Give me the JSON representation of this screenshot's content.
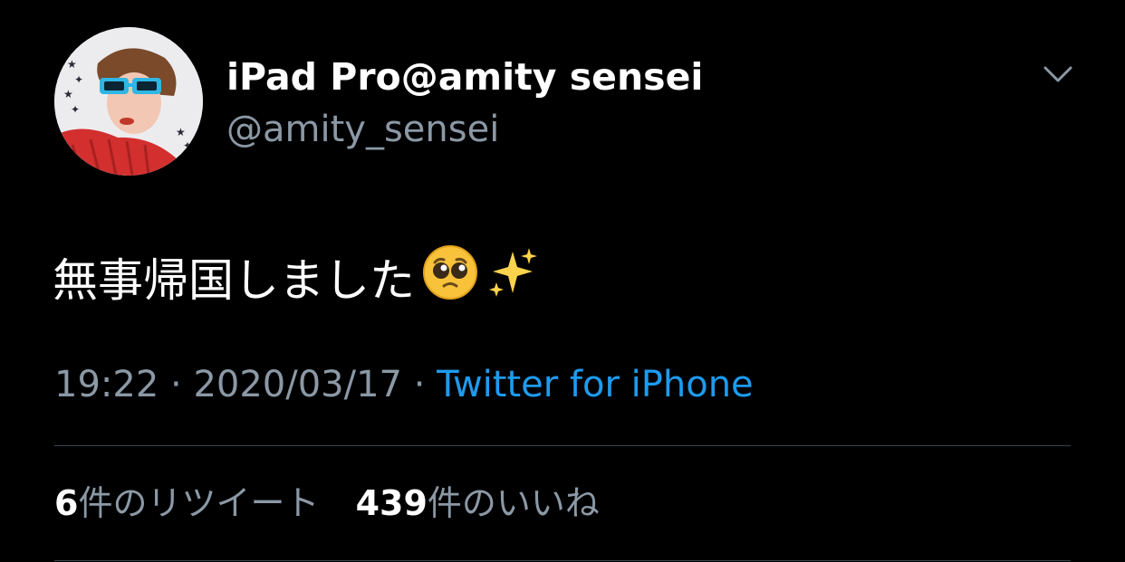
{
  "author": {
    "display_name": "iPad Pro@amity sensei",
    "handle": "@amity_sensei",
    "avatar_icon": "profile-photo-woman-blue-sunglasses"
  },
  "tweet": {
    "text": "無事帰国しました",
    "emoji": [
      "pleading-face-icon",
      "sparkles-icon"
    ]
  },
  "meta": {
    "time": "19:22",
    "separator": "·",
    "date": "2020/03/17",
    "source": "Twitter for iPhone"
  },
  "stats": {
    "retweets_count": "6",
    "retweets_label": "件のリツイート",
    "likes_count": "439",
    "likes_label": "件のいいね"
  },
  "colors": {
    "background": "#000000",
    "primary_text": "#ffffff",
    "secondary_text": "#8b98a5",
    "link": "#1d9bf0",
    "divider": "#38444d"
  },
  "icons": {
    "menu": "chevron-down-icon"
  }
}
